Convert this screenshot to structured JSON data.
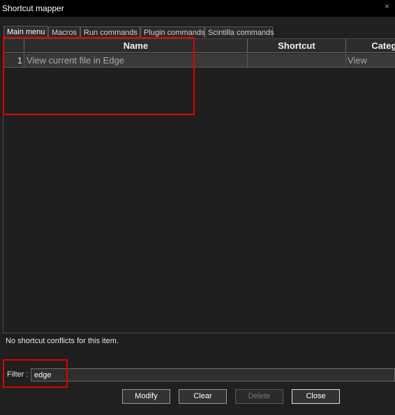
{
  "window": {
    "title": "Shortcut mapper",
    "close_glyph": "×"
  },
  "tabs": [
    {
      "label": "Main menu",
      "active": true
    },
    {
      "label": "Macros",
      "active": false
    },
    {
      "label": "Run commands",
      "active": false
    },
    {
      "label": "Plugin commands",
      "active": false
    },
    {
      "label": "Scintilla commands",
      "active": false
    }
  ],
  "grid": {
    "columns": [
      "",
      "Name",
      "Shortcut",
      "Category"
    ],
    "rows": [
      {
        "index": "1",
        "name": "View current file in Edge",
        "shortcut": "",
        "category": "View"
      }
    ]
  },
  "conflicts": {
    "message": "No shortcut conflicts for this item."
  },
  "filter": {
    "label": "Filter :",
    "value": "edge"
  },
  "buttons": {
    "modify": "Modify",
    "clear": "Clear",
    "delete": "Delete",
    "close": "Close"
  },
  "colors": {
    "highlight": "#e00000",
    "background": "#202020"
  }
}
